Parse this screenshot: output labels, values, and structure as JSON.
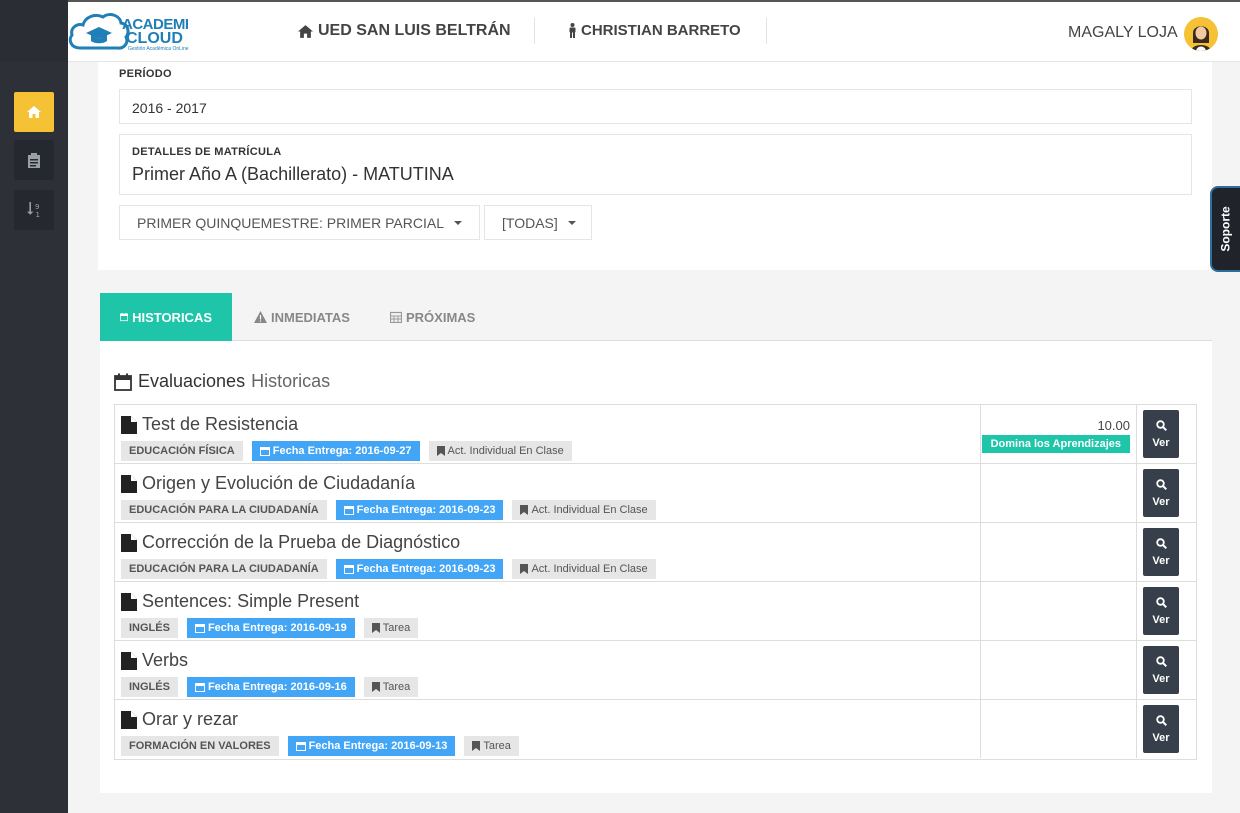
{
  "header": {
    "brand_line1": "ACADEMI",
    "brand_line2": "CLOUD",
    "brand_sub": "Gestión Académica OnLine",
    "school": "UED SAN LUIS BELTRÁN",
    "student": "CHRISTIAN BARRETO",
    "user": "MAGALY LOJA"
  },
  "sidebar": {
    "items": [
      {
        "icon": "home-icon"
      },
      {
        "icon": "clipboard-icon"
      },
      {
        "icon": "sort-numeric-icon"
      }
    ]
  },
  "filters": {
    "periodo_label": "PERÍODO",
    "periodo_value": "2016 - 2017",
    "detalle_label": "DETALLES DE MATRÍCULA",
    "detalle_value": "Primer Año A (Bachillerato) - MATUTINA",
    "quimestre_dropdown": "PRIMER QUINQUEMESTRE: PRIMER PARCIAL",
    "todas_dropdown": "[TODAS]"
  },
  "soporte_label": "Soporte",
  "tabs": [
    {
      "label": "HISTORICAS",
      "active": true
    },
    {
      "label": "INMEDIATAS",
      "active": false
    },
    {
      "label": "PRÓXIMAS",
      "active": false
    }
  ],
  "evaluations": {
    "title": "Evaluaciones",
    "subtitle": "Historicas",
    "ver_label": "Ver",
    "rows": [
      {
        "title": "Test de Resistencia",
        "subject": "EDUCACIÓN FÍSICA",
        "date": "Fecha Entrega: 2016-09-27",
        "type": "Act. Individual En Clase",
        "grade": "10.00",
        "grade_label": "Domina los Aprendizajes"
      },
      {
        "title": "Origen y Evolución de Ciudadanía",
        "subject": "EDUCACIÓN PARA LA CIUDADANÍA",
        "date": "Fecha Entrega: 2016-09-23",
        "type": "Act. Individual En Clase",
        "grade": "",
        "grade_label": ""
      },
      {
        "title": "Corrección de la Prueba de Diagnóstico",
        "subject": "EDUCACIÓN PARA LA CIUDADANÍA",
        "date": "Fecha Entrega: 2016-09-23",
        "type": "Act. Individual En Clase",
        "grade": "",
        "grade_label": ""
      },
      {
        "title": "Sentences: Simple Present",
        "subject": "INGLÉS",
        "date": "Fecha Entrega: 2016-09-19",
        "type": "Tarea",
        "grade": "",
        "grade_label": ""
      },
      {
        "title": "Verbs",
        "subject": "INGLÉS",
        "date": "Fecha Entrega: 2016-09-16",
        "type": "Tarea",
        "grade": "",
        "grade_label": ""
      },
      {
        "title": "Orar y rezar",
        "subject": "FORMACIÓN EN VALORES",
        "date": "Fecha Entrega: 2016-09-13",
        "type": "Tarea",
        "grade": "",
        "grade_label": ""
      }
    ]
  },
  "colors": {
    "accent_teal": "#1fc5a8",
    "date_blue": "#42a5f5",
    "sidebar_dark": "#2e3038",
    "home_yellow": "#f5c135"
  }
}
